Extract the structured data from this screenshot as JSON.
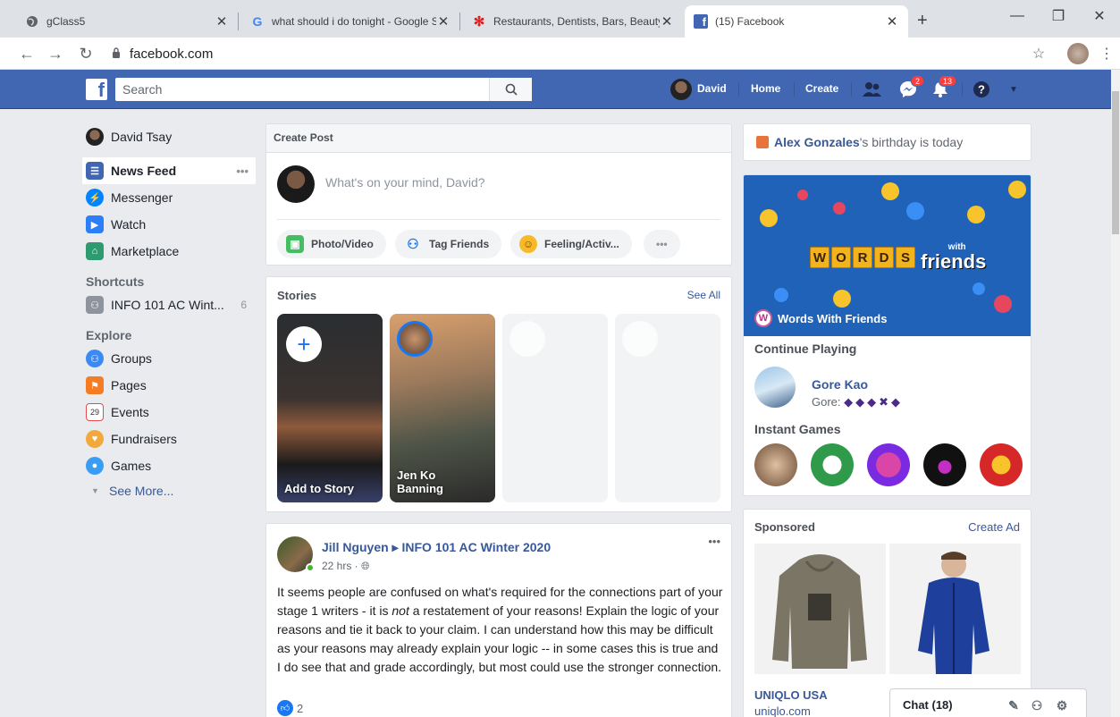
{
  "browser": {
    "tabs": [
      {
        "title": "gClass5",
        "active": false
      },
      {
        "title": "what should i do tonight - Google S",
        "active": false
      },
      {
        "title": "Restaurants, Dentists, Bars, Beauty S",
        "active": false
      },
      {
        "title": "(15) Facebook",
        "active": true
      }
    ],
    "url": "facebook.com",
    "new_tab": "+"
  },
  "header": {
    "search_placeholder": "Search",
    "user_name": "David",
    "home": "Home",
    "create": "Create",
    "messenger_badge": "2",
    "notifications_badge": "13",
    "brand_color": "#4267b2"
  },
  "left_nav": {
    "profile_name": "David Tsay",
    "items": [
      {
        "label": "News Feed",
        "icon": "news-feed-icon",
        "color": "#4267b2"
      },
      {
        "label": "Messenger",
        "icon": "messenger-icon",
        "color": "#0084ff"
      },
      {
        "label": "Watch",
        "icon": "watch-icon",
        "color": "#2d7ff9"
      },
      {
        "label": "Marketplace",
        "icon": "marketplace-icon",
        "color": "#2e9a6f"
      }
    ],
    "more_dots": "•••",
    "shortcuts_title": "Shortcuts",
    "shortcut": {
      "label": "INFO 101 AC Wint...",
      "count": "6"
    },
    "explore_title": "Explore",
    "explore": [
      {
        "label": "Groups",
        "icon": "groups-icon",
        "color": "#3b8af4"
      },
      {
        "label": "Pages",
        "icon": "pages-icon",
        "color": "#f57c22"
      },
      {
        "label": "Events",
        "icon": "events-icon",
        "color": "#e64b4b"
      },
      {
        "label": "Fundraisers",
        "icon": "fundraisers-icon",
        "color": "#f2a93b"
      },
      {
        "label": "Games",
        "icon": "games-icon",
        "color": "#3a9df4"
      }
    ],
    "see_more": "See More..."
  },
  "create_post": {
    "title": "Create Post",
    "placeholder": "What's on your mind, David?",
    "actions": [
      "Photo/Video",
      "Tag Friends",
      "Feeling/Activ...",
      "•••"
    ]
  },
  "stories": {
    "title": "Stories",
    "see_all": "See All",
    "add_label": "Add to Story",
    "plus": "+",
    "friend_story": "Jen Ko Banning"
  },
  "post": {
    "author": "Jill Nguyen ▸ INFO 101 AC Winter 2020",
    "time": "22 hrs ·",
    "body_pre": "It seems people are confused on what's required for the connections part of your stage 1 writers - it is ",
    "body_em": "not",
    "body_post": " a restatement of your reasons! Explain the logic of your reasons and tie it back to your claim. I can understand how this may be difficult as your reasons may already explain your logic -- in some cases this is true and I do see that and grade accordingly, but most could use the stronger connection.",
    "likes": "2",
    "more": "•••"
  },
  "right": {
    "birthday_name": "Alex Gonzales",
    "birthday_rest": "'s birthday is today",
    "game_caption": "Words With Friends",
    "game_badge": "W",
    "logo_letters": [
      "W",
      "O",
      "R",
      "D",
      "S"
    ],
    "logo_with": "with",
    "logo_friends": "friends",
    "continue_playing": "Continue Playing",
    "player_name": "Gore Kao",
    "player_score": "Gore:",
    "instant_games": "Instant Games",
    "sponsored": "Sponsored",
    "create_ad": "Create Ad",
    "ad_brand": "UNIQLO USA",
    "ad_url": "uniqlo.com"
  },
  "chat": {
    "label": "Chat (18)"
  }
}
